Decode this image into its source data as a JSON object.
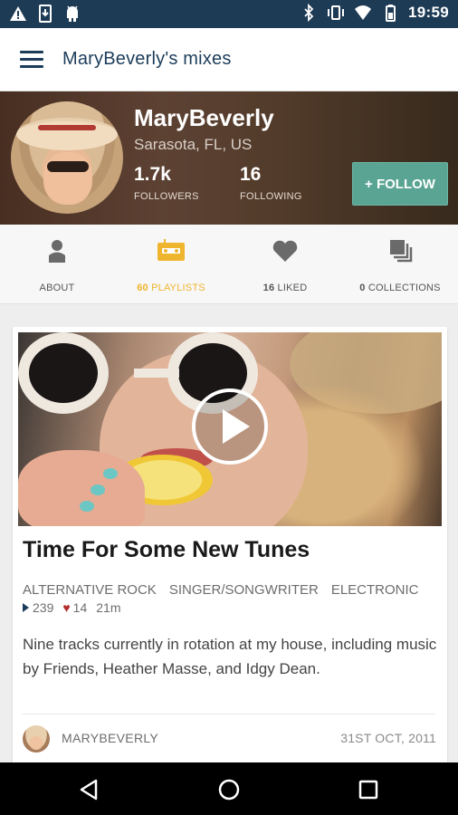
{
  "status_bar": {
    "time": "19:59",
    "left_icons": [
      "warning-icon",
      "download-icon",
      "android-icon"
    ],
    "right_icons": [
      "bluetooth-icon",
      "vibrate-icon",
      "wifi-icon",
      "battery-icon"
    ]
  },
  "app_bar": {
    "title": "MaryBeverly's mixes",
    "menu_icon": "hamburger-menu-icon"
  },
  "profile": {
    "name": "MaryBeverly",
    "location": "Sarasota, FL, US",
    "followers_count": "1.7k",
    "followers_label": "FOLLOWERS",
    "following_count": "16",
    "following_label": "FOLLOWING",
    "follow_button": "+ FOLLOW"
  },
  "tabs": [
    {
      "count": "",
      "label": "ABOUT",
      "icon": "person-icon",
      "active": false
    },
    {
      "count": "60",
      "label": "PLAYLISTS",
      "icon": "cassette-icon",
      "active": true
    },
    {
      "count": "16",
      "label": "LIKED",
      "icon": "heart-icon",
      "active": false
    },
    {
      "count": "0",
      "label": "COLLECTIONS",
      "icon": "collections-icon",
      "active": false
    }
  ],
  "mix": {
    "title": "Time For Some New Tunes",
    "genres": [
      "ALTERNATIVE ROCK",
      "SINGER/SONGWRITER",
      "ELECTRONIC"
    ],
    "plays": "239",
    "likes": "14",
    "duration": "21m",
    "description": "Nine tracks currently in rotation at my house, including music by Friends, Heather Masse, and Idgy Dean.",
    "author": "MARYBEVERLY",
    "date": "31ST OCT, 2011"
  },
  "colors": {
    "status_bar_bg": "#1e3b55",
    "title_color": "#1c3d5a",
    "accent": "#f0b52e",
    "follow_button_bg": "#5aa493",
    "heart": "#b22f2f"
  },
  "nav_bar": {
    "buttons": [
      "back-icon",
      "home-icon",
      "recents-icon"
    ]
  }
}
